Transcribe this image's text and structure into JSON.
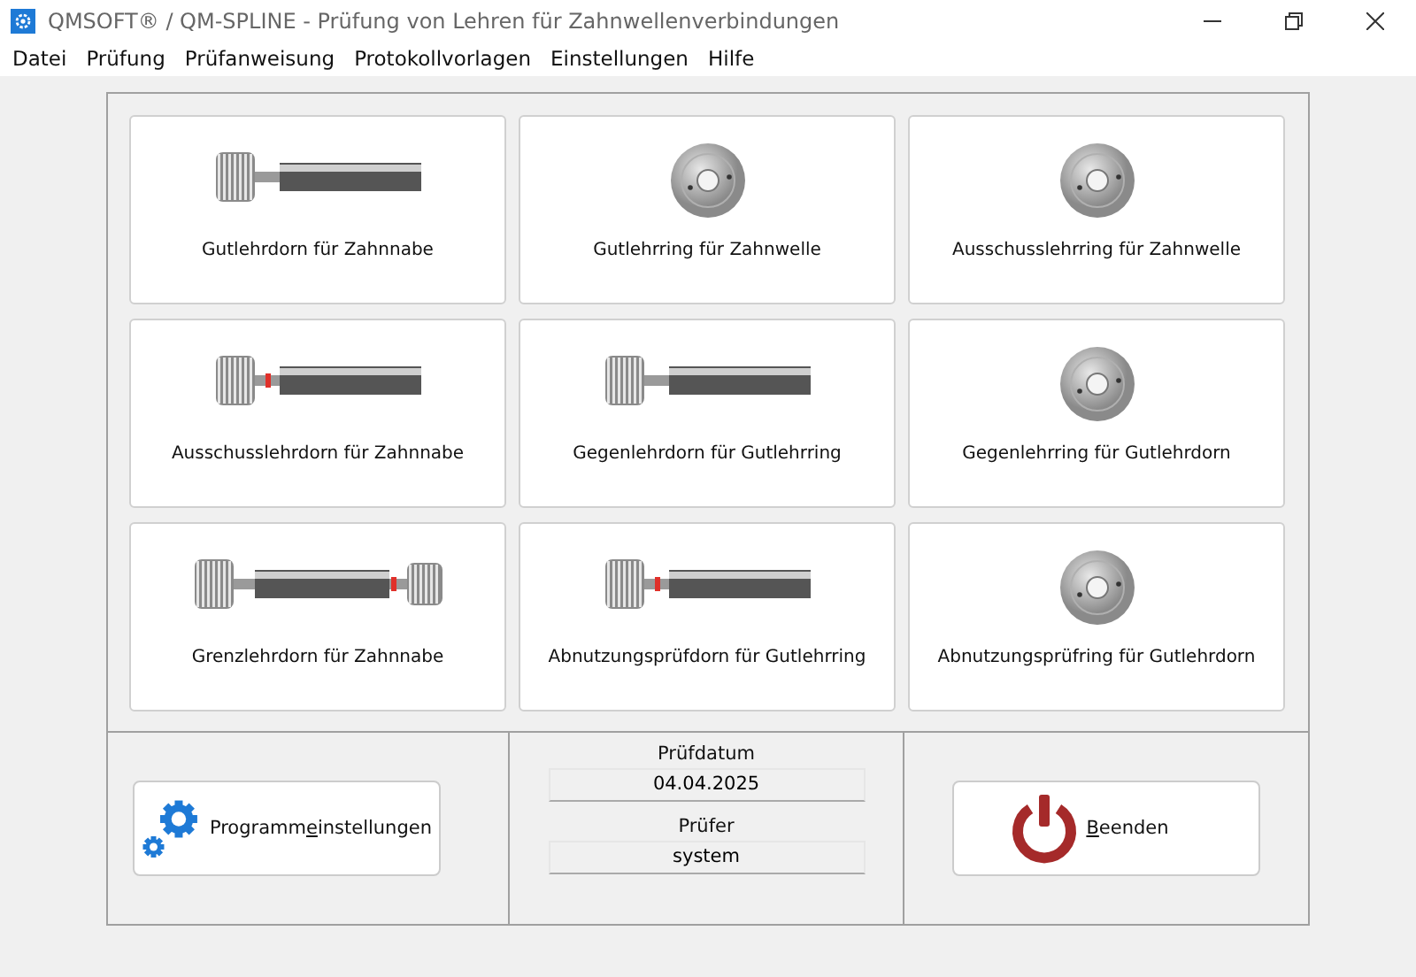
{
  "window": {
    "title": "QMSOFT® / QM-SPLINE - Prüfung von Lehren für Zahnwellenverbindungen"
  },
  "menu": [
    "Datei",
    "Prüfung",
    "Prüfanweisung",
    "Protokollvorlagen",
    "Einstellungen",
    "Hilfe"
  ],
  "tiles": [
    {
      "label": "Gutlehrdorn für Zahnnabe",
      "kind": "plug",
      "red_mark": false
    },
    {
      "label": "Gutlehrring für Zahnwelle",
      "kind": "ring"
    },
    {
      "label": "Ausschusslehrring für Zahnwelle",
      "kind": "ring"
    },
    {
      "label": "Ausschusslehrdorn für Zahnnabe",
      "kind": "plug",
      "red_mark": true
    },
    {
      "label": "Gegenlehrdorn für Gutlehrring",
      "kind": "plug",
      "red_mark": false
    },
    {
      "label": "Gegenlehrring für Gutlehrdorn",
      "kind": "ring"
    },
    {
      "label": "Grenzlehrdorn für Zahnnabe",
      "kind": "limit_plug"
    },
    {
      "label": "Abnutzungsprüfdorn für Gutlehrring",
      "kind": "plug",
      "red_mark": true
    },
    {
      "label": "Abnutzungsprüfring für Gutlehrdorn",
      "kind": "ring"
    }
  ],
  "settings_button": {
    "text_before": "Programm",
    "access_key": "e",
    "text_after": "instellungen"
  },
  "date": {
    "label": "Prüfdatum",
    "value": "04.04.2025"
  },
  "inspector": {
    "label": "Prüfer",
    "value": "system"
  },
  "exit_button": {
    "access_key": "B",
    "text_after": "eenden"
  }
}
